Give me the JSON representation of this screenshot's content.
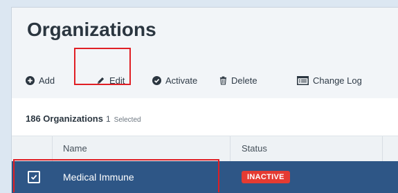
{
  "page": {
    "title": "Organizations"
  },
  "toolbar": {
    "add_label": "Add",
    "edit_label": "Edit",
    "activate_label": "Activate",
    "delete_label": "Delete",
    "changelog_label": "Change Log"
  },
  "summary": {
    "count_text": "186 Organizations",
    "selected_count": "1",
    "selected_label": "Selected"
  },
  "table": {
    "columns": [
      "Name",
      "Status"
    ],
    "rows": [
      {
        "name": "Medical Immune",
        "status": "INACTIVE",
        "checked": true
      }
    ]
  },
  "colors": {
    "accent_highlight": "#e01e24",
    "selected_row": "#2e5686",
    "inactive_badge": "#e53b32"
  },
  "icons": {
    "add": "plus-circle-icon",
    "edit": "pencil-icon",
    "activate": "check-circle-icon",
    "delete": "trash-icon",
    "changelog": "list-icon",
    "checkbox": "checkbox-checked-icon"
  }
}
